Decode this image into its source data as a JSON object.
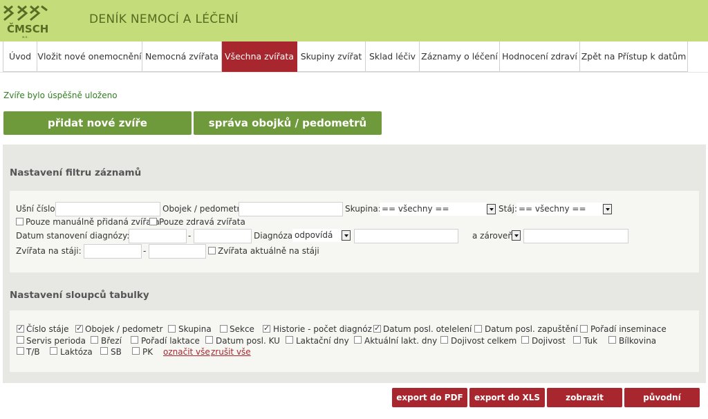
{
  "header": {
    "logo_text": "ČMSCH",
    "logo_sub": "a.s.",
    "title": "DENÍK NEMOCÍ A LÉČENÍ",
    "bg_color": "#c4dc7a"
  },
  "nav": {
    "items": [
      {
        "label": "Úvod"
      },
      {
        "label": "Vložit nové onemocnění"
      },
      {
        "label": "Nemocná zvířata"
      },
      {
        "label": "Všechna zvířata",
        "active": true
      },
      {
        "label": "Skupiny zvířat"
      },
      {
        "label": "Sklad léčiv"
      },
      {
        "label": "Záznamy o léčení"
      },
      {
        "label": "Hodnocení zdraví"
      },
      {
        "label": "Zpět na Přístup k datům"
      }
    ],
    "active_color": "#a8262d"
  },
  "status_message": "Zvíře bylo úspěšně uloženo",
  "actions": {
    "add_animal": "přidat nové zvíře",
    "manage_collars": "správa obojků / pedometrů"
  },
  "filter": {
    "heading": "Nastavení filtru záznamů",
    "ear_number_label": "Ušní číslo:",
    "ear_number_value": "",
    "collar_label": "Obojek / pedometr:",
    "collar_value": "",
    "group_label": "Skupina:",
    "group_value": "== všechny ==",
    "stable_label": "Stáj:",
    "stable_value": "== všechny ==",
    "manual_only_label": "Pouze manuálně přidaná zvířata",
    "healthy_only_label": "Pouze zdravá zvířata",
    "diag_date_label": "Datum stanovení diagnózy:",
    "range_sep": "-",
    "diagnosis_label": "Diagnóza:",
    "diagnosis_mode": "odpovídá",
    "and_label": "a zároveň",
    "in_stable_label": "Zvířata na stáji:",
    "currently_in_stable_label": "Zvířata aktuálně na stáji"
  },
  "columns": {
    "heading": "Nastavení sloupců tabulky",
    "items": [
      {
        "label": "Číslo stáje",
        "checked": true
      },
      {
        "label": "Obojek / pedometr",
        "checked": true
      },
      {
        "label": "Skupina",
        "checked": false
      },
      {
        "label": "Sekce",
        "checked": false
      },
      {
        "label": "Historie - počet diagnóz",
        "checked": true
      },
      {
        "label": "Datum posl. otelelení",
        "checked": true
      },
      {
        "label": "Datum posl. zapuštění",
        "checked": false
      },
      {
        "label": "Pořadí inseminace",
        "checked": false
      },
      {
        "label": "Servis perioda",
        "checked": false
      },
      {
        "label": "Březí",
        "checked": false
      },
      {
        "label": "Pořadí laktace",
        "checked": false
      },
      {
        "label": "Datum posl. KU",
        "checked": false
      },
      {
        "label": "Laktační dny",
        "checked": false
      },
      {
        "label": "Aktuální lakt. dny",
        "checked": false
      },
      {
        "label": "Dojivost celkem",
        "checked": false
      },
      {
        "label": "Dojivost",
        "checked": false
      },
      {
        "label": "Tuk",
        "checked": false
      },
      {
        "label": "Bílkovina",
        "checked": false
      },
      {
        "label": "T/B",
        "checked": false
      },
      {
        "label": "Laktóza",
        "checked": false
      },
      {
        "label": "SB",
        "checked": false
      },
      {
        "label": "PK",
        "checked": false
      }
    ],
    "select_all": "označit vše",
    "deselect_all": "zrušit vše"
  },
  "footer_buttons": {
    "export_pdf": "export do PDF",
    "export_xls": "export do XLS",
    "show": "zobrazit",
    "original": "původní"
  },
  "colors": {
    "green_button": "#6f9a3c",
    "red_button": "#a8262d",
    "success_text": "#2f7d1f"
  }
}
